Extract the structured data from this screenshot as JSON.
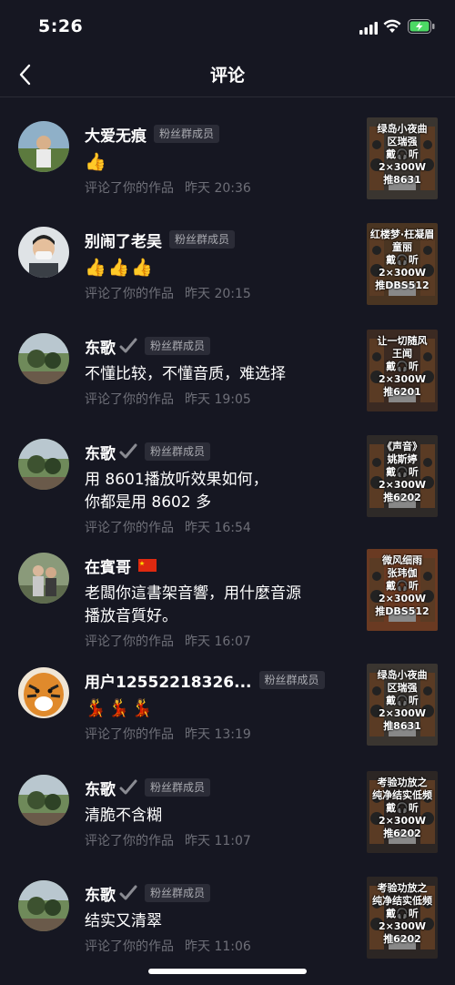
{
  "status": {
    "time": "5:26"
  },
  "header": {
    "title": "评论"
  },
  "colors": {
    "background": "#161722",
    "meta": "#6e6f78",
    "badge_bg": "#2b2c37"
  },
  "comments": [
    {
      "name": "大爱无痕",
      "badge": "粉丝群成员",
      "verified": false,
      "flag": false,
      "text_lines": [],
      "emojis": [
        "👍"
      ],
      "action": "评论了你的作品",
      "time": "昨天 20:36",
      "thumb_lines": [
        "绿岛小夜曲",
        "区瑞强",
        "戴🎧听",
        "2×300W",
        "推8631"
      ],
      "thumb_color": "#3a3530"
    },
    {
      "name": "别闹了老吴",
      "badge": "粉丝群成员",
      "verified": false,
      "flag": false,
      "text_lines": [],
      "emojis": [
        "👍",
        "👍",
        "👍"
      ],
      "action": "评论了你的作品",
      "time": "昨天 20:15",
      "thumb_lines": [
        "红楼梦·枉凝眉",
        "童丽",
        "戴🎧听",
        "2×300W",
        "推DBS512"
      ],
      "thumb_color": "#4a3522"
    },
    {
      "name": "东歌",
      "badge": "粉丝群成员",
      "verified": true,
      "flag": false,
      "text_lines": [
        "不懂比较，不懂音质，难选择"
      ],
      "emojis": [],
      "action": "评论了你的作品",
      "time": "昨天 19:05",
      "thumb_lines": [
        "让一切随风",
        "王闻",
        "戴🎧听",
        "2×300W",
        "推6201"
      ],
      "thumb_color": "#3b2a22"
    },
    {
      "name": "东歌",
      "badge": "粉丝群成员",
      "verified": true,
      "flag": false,
      "text_lines": [
        "用 8601播放听效果如何，",
        "你都是用 8602 多"
      ],
      "emojis": [],
      "action": "评论了你的作品",
      "time": "昨天 16:54",
      "thumb_lines": [
        "《声音》",
        "姚斯婷",
        "戴🎧听",
        "2×300W",
        "推6202"
      ],
      "thumb_color": "#2e2a28"
    },
    {
      "name": "在賓哥",
      "badge": "",
      "verified": false,
      "flag": true,
      "text_lines": [
        "老闆你這書架音響，用什麼音源",
        "播放音質好。"
      ],
      "emojis": [],
      "action": "评论了你的作品",
      "time": "昨天 16:07",
      "thumb_lines": [
        "微风细雨",
        "张玮伽",
        "戴🎧听",
        "2×300W",
        "推DBS512"
      ],
      "thumb_color": "#6a3a22"
    },
    {
      "name": "用户12552218326...",
      "badge": "粉丝群成员",
      "verified": false,
      "flag": false,
      "text_lines": [],
      "emojis": [
        "💃",
        "💃",
        "💃"
      ],
      "action": "评论了你的作品",
      "time": "昨天 13:19",
      "thumb_lines": [
        "绿岛小夜曲",
        "区瑞强",
        "戴🎧听",
        "2×300W",
        "推8631"
      ],
      "thumb_color": "#3a3530"
    },
    {
      "name": "东歌",
      "badge": "粉丝群成员",
      "verified": true,
      "flag": false,
      "text_lines": [
        "清脆不含糊"
      ],
      "emojis": [],
      "action": "评论了你的作品",
      "time": "昨天 11:07",
      "thumb_lines": [
        "考验功放之",
        "纯净结实低频",
        "戴🎧听",
        "2×300W",
        "推6202"
      ],
      "thumb_color": "#2c2624"
    },
    {
      "name": "东歌",
      "badge": "粉丝群成员",
      "verified": true,
      "flag": false,
      "text_lines": [
        "结实又清翠"
      ],
      "emojis": [],
      "action": "评论了你的作品",
      "time": "昨天 11:06",
      "thumb_lines": [
        "考验功放之",
        "纯净结实低频",
        "戴🎧听",
        "2×300W",
        "推6202"
      ],
      "thumb_color": "#2c2624"
    }
  ]
}
